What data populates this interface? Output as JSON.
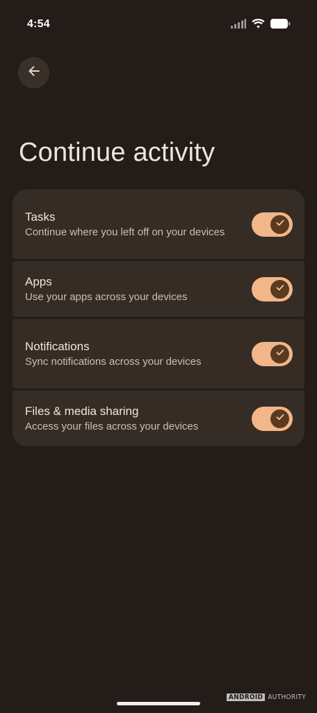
{
  "status_bar": {
    "time": "4:54",
    "icons": [
      "signal-icon",
      "wifi-icon",
      "battery-icon"
    ]
  },
  "header": {
    "back_icon": "arrow-left-icon",
    "title": "Continue activity"
  },
  "settings": [
    {
      "title": "Tasks",
      "description": "Continue where you left off on your devices",
      "enabled": true
    },
    {
      "title": "Apps",
      "description": "Use your apps across your devices",
      "enabled": true
    },
    {
      "title": "Notifications",
      "description": "Sync notifications across your devices",
      "enabled": true
    },
    {
      "title": "Files & media sharing",
      "description": "Access your files across your devices",
      "enabled": true
    }
  ],
  "watermark": {
    "brand_a": "ANDROID",
    "brand_b": "AUTHORITY"
  },
  "colors": {
    "background": "#231c18",
    "card": "#352c26",
    "toggle_track": "#f2b688",
    "toggle_thumb": "#5b3a20",
    "title_text": "#f0e4da",
    "secondary_text": "#cdbfb4"
  }
}
